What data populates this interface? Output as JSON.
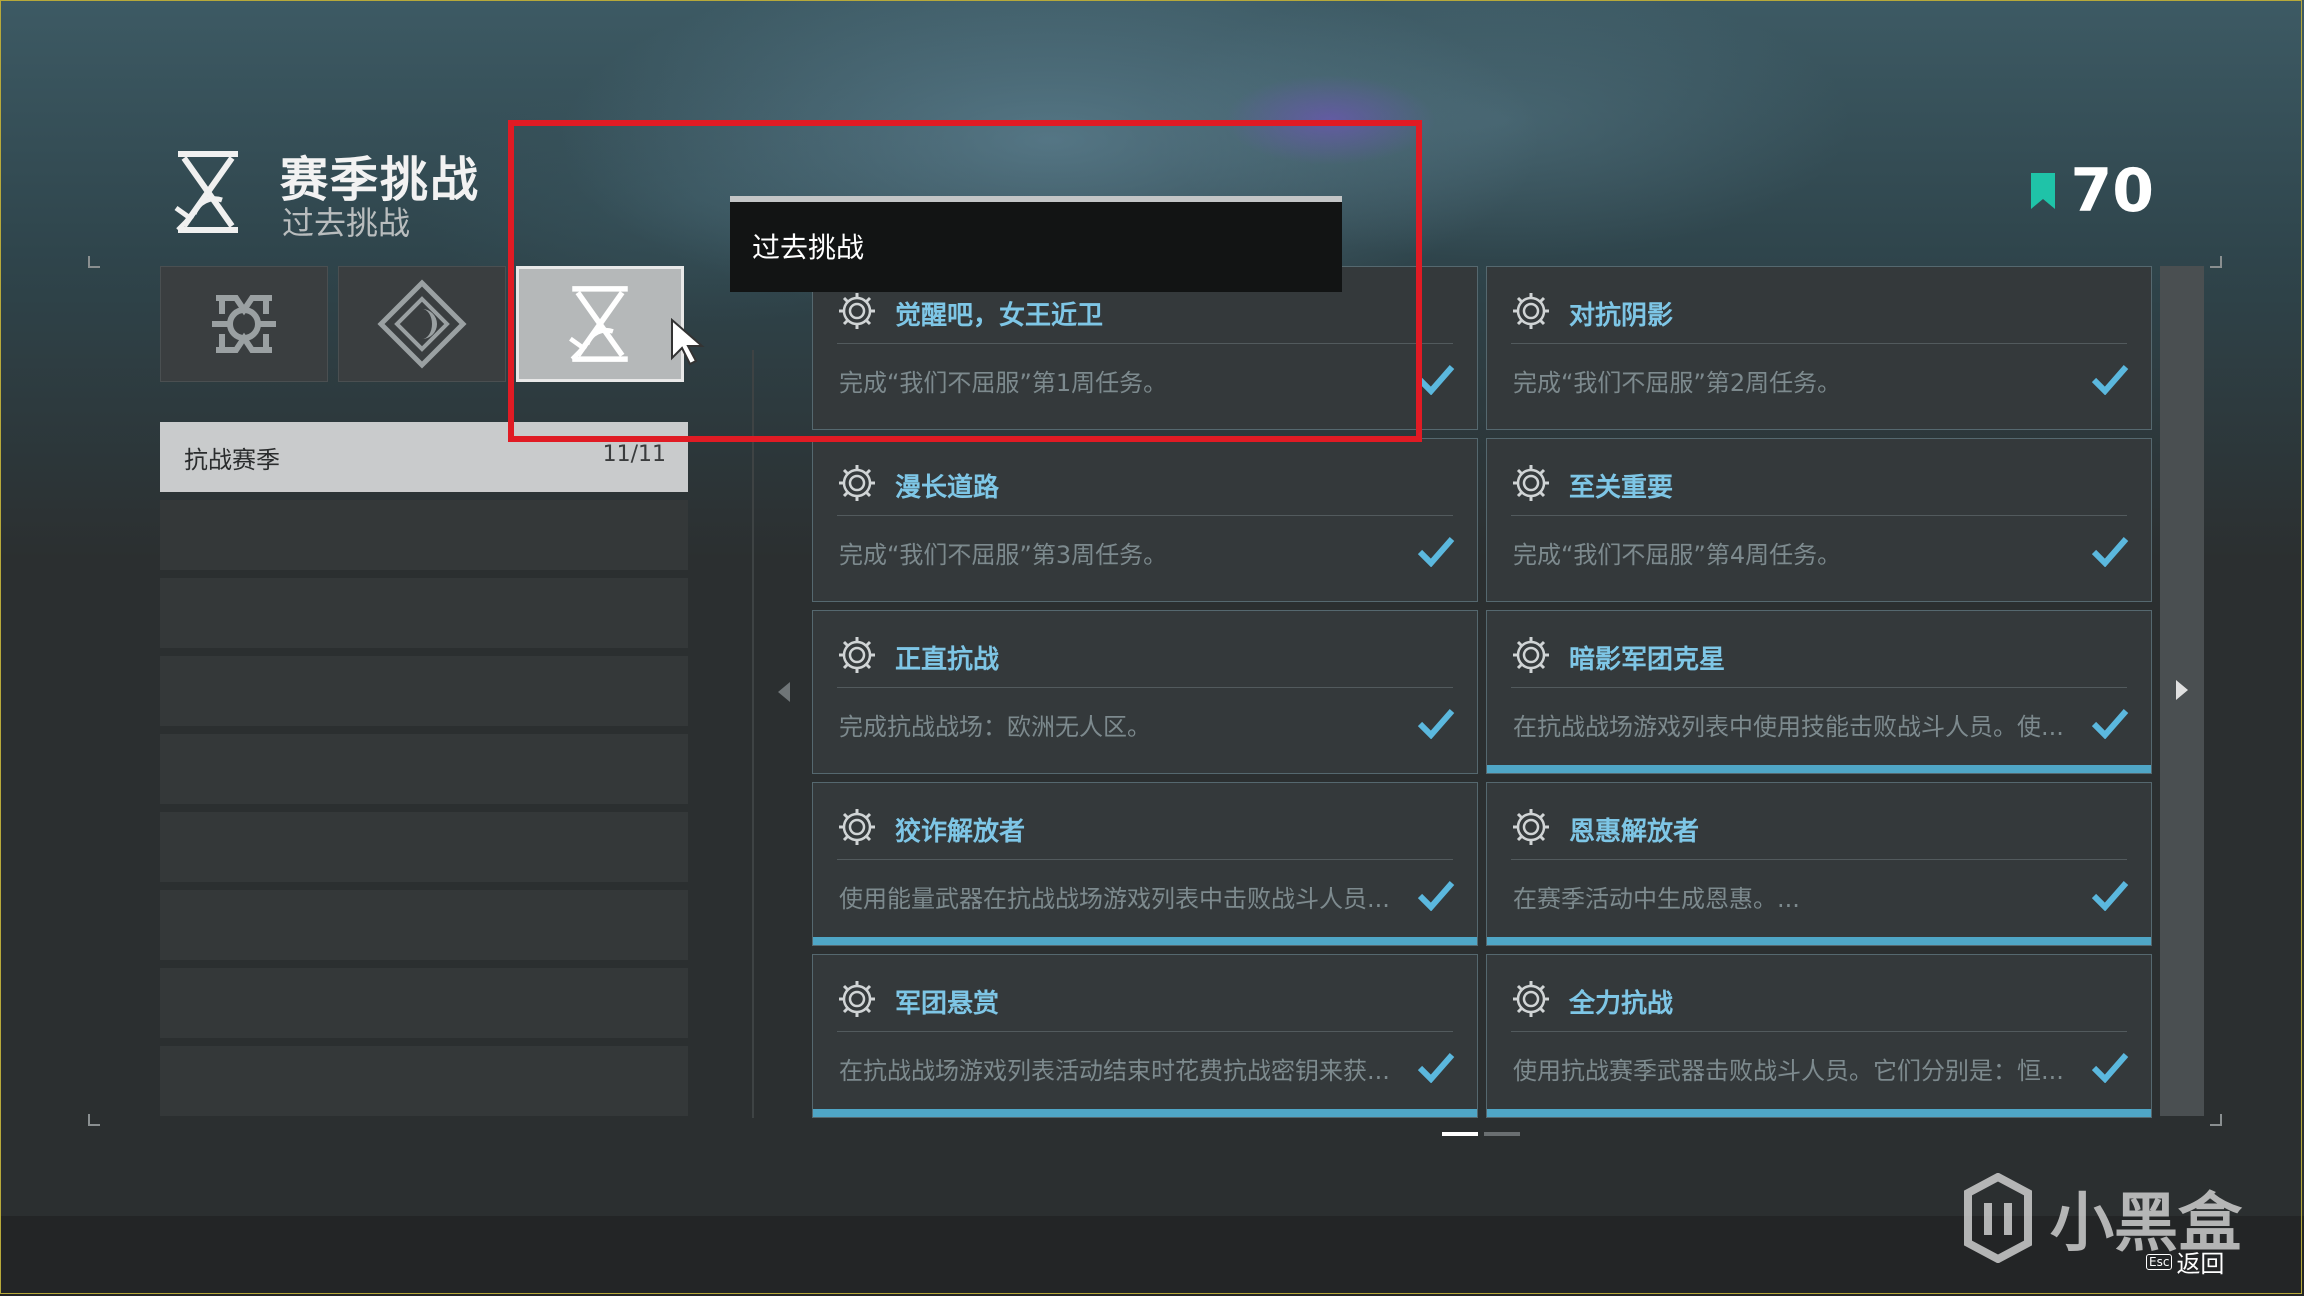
{
  "header": {
    "title": "赛季挑战",
    "subtitle": "过去挑战",
    "currency_value": "70",
    "icon": "hourglass-icon",
    "currency_icon": "bookmark-icon",
    "accent_color": "#4fa6c6"
  },
  "tabs": [
    {
      "icon": "clan-emblem-icon",
      "active": false
    },
    {
      "icon": "diamond-eye-icon",
      "active": false
    },
    {
      "icon": "hourglass-icon",
      "active": true
    }
  ],
  "tooltip": {
    "text": "过去挑战"
  },
  "list": {
    "items": [
      {
        "name": "抗战赛季",
        "count": "11/11",
        "selected": true
      }
    ],
    "empty_rows": 8
  },
  "cards": [
    {
      "title": "觉醒吧，女王近卫",
      "desc": "完成“我们不屈服”第1周任务。",
      "completed": true,
      "bar": false
    },
    {
      "title": "对抗阴影",
      "desc": "完成“我们不屈服”第2周任务。",
      "completed": true,
      "bar": false
    },
    {
      "title": "漫长道路",
      "desc": "完成“我们不屈服”第3周任务。",
      "completed": true,
      "bar": false
    },
    {
      "title": "至关重要",
      "desc": "完成“我们不屈服”第4周任务。",
      "completed": true,
      "bar": false
    },
    {
      "title": "正直抗战",
      "desc": "完成抗战战场：欧洲无人区。",
      "completed": true,
      "bar": false
    },
    {
      "title": "暗影军团克星",
      "desc": "在抗战战场游戏列表中使用技能击败战斗人员。使...",
      "completed": true,
      "bar": true
    },
    {
      "title": "狡诈解放者",
      "desc": "使用能量武器在抗战战场游戏列表中击败战斗人员...",
      "completed": true,
      "bar": true
    },
    {
      "title": "恩惠解放者",
      "desc": "在赛季活动中生成恩惠。...",
      "completed": true,
      "bar": true
    },
    {
      "title": "军团悬赏",
      "desc": "在抗战战场游戏列表活动结束时花费抗战密钥来获...",
      "completed": true,
      "bar": true
    },
    {
      "title": "全力抗战",
      "desc": "使用抗战赛季武器击败战斗人员。它们分别是：恒...",
      "completed": true,
      "bar": true
    }
  ],
  "pager": {
    "pages": 2,
    "current": 1
  },
  "watermark": {
    "text": "小黑盒"
  },
  "footer": {
    "key": "Esc",
    "label": "返回"
  }
}
